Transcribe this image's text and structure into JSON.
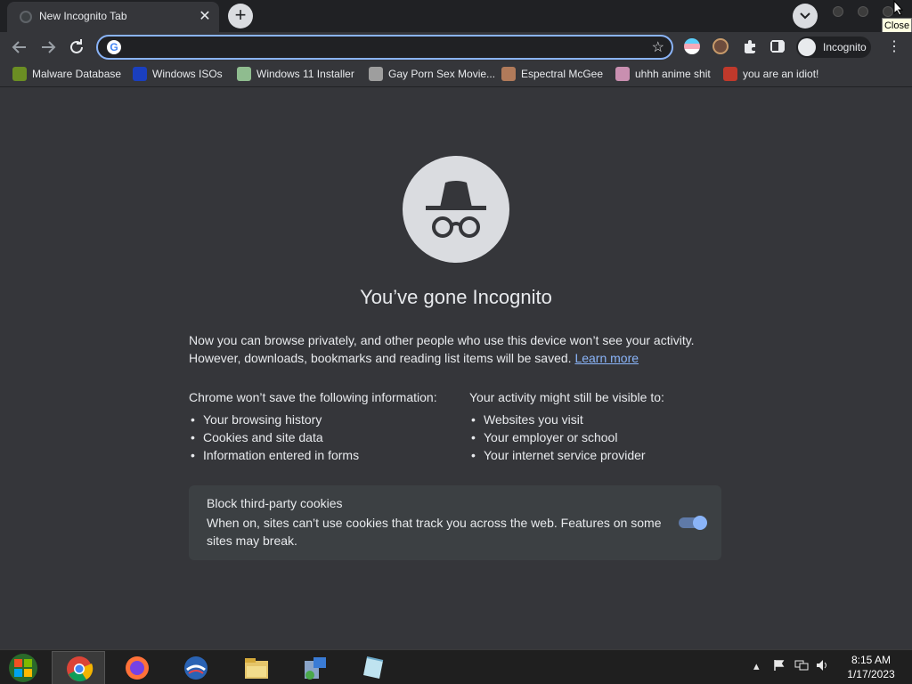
{
  "browser": {
    "tab": {
      "title": "New Incognito Tab",
      "close_glyph": "✕"
    },
    "new_tab_glyph": "+",
    "tooltip": "Close",
    "omnibox": {
      "value": "",
      "engine_letter": "G"
    },
    "star_glyph": "☆",
    "profile_label": "Incognito",
    "menu_glyph": "⋮"
  },
  "bookmarks": [
    {
      "label": "Malware Database",
      "icon": "malware-icon",
      "color": "#6b8e23"
    },
    {
      "label": "Windows ISOs",
      "icon": "x-icon",
      "color": "#1a3fbf"
    },
    {
      "label": "Windows 11 Installer",
      "icon": "installer-icon",
      "color": "#8fbc8f"
    },
    {
      "label": "Gay Porn Sex Movie...",
      "icon": "site-icon",
      "color": "#9e9e9e"
    },
    {
      "label": "Espectral McGee",
      "icon": "avatar-icon",
      "color": "#b07a5a"
    },
    {
      "label": "uhhh anime shit",
      "icon": "anime-icon",
      "color": "#c98fb0"
    },
    {
      "label": "you are an idiot!",
      "icon": "flag-icon",
      "color": "#c0392b"
    }
  ],
  "page": {
    "headline": "You’ve gone Incognito",
    "intro_line1": "Now you can browse privately, and other people who use this device won’t see your activity.",
    "intro_line2": "However, downloads, bookmarks and reading list items will be saved.",
    "learn_more": "Learn more",
    "left_col": {
      "head": "Chrome won’t save the following information:",
      "items": [
        "Your browsing history",
        "Cookies and site data",
        "Information entered in forms"
      ]
    },
    "right_col": {
      "head": "Your activity might still be visible to:",
      "items": [
        "Websites you visit",
        "Your employer or school",
        "Your internet service provider"
      ]
    },
    "cookie_card": {
      "title": "Block third-party cookies",
      "desc": "When on, sites can’t use cookies that track you across the web. Features on some sites may break.",
      "toggle_on": true
    }
  },
  "taskbar": {
    "apps": [
      "chrome",
      "firefox",
      "opera",
      "file-explorer",
      "network-tool",
      "notepad"
    ],
    "clock": {
      "time": "8:15 AM",
      "date": "1/17/2023"
    }
  },
  "colors": {
    "accent": "#8ab4f8",
    "bg": "#35363a",
    "tabstrip": "#202124"
  }
}
